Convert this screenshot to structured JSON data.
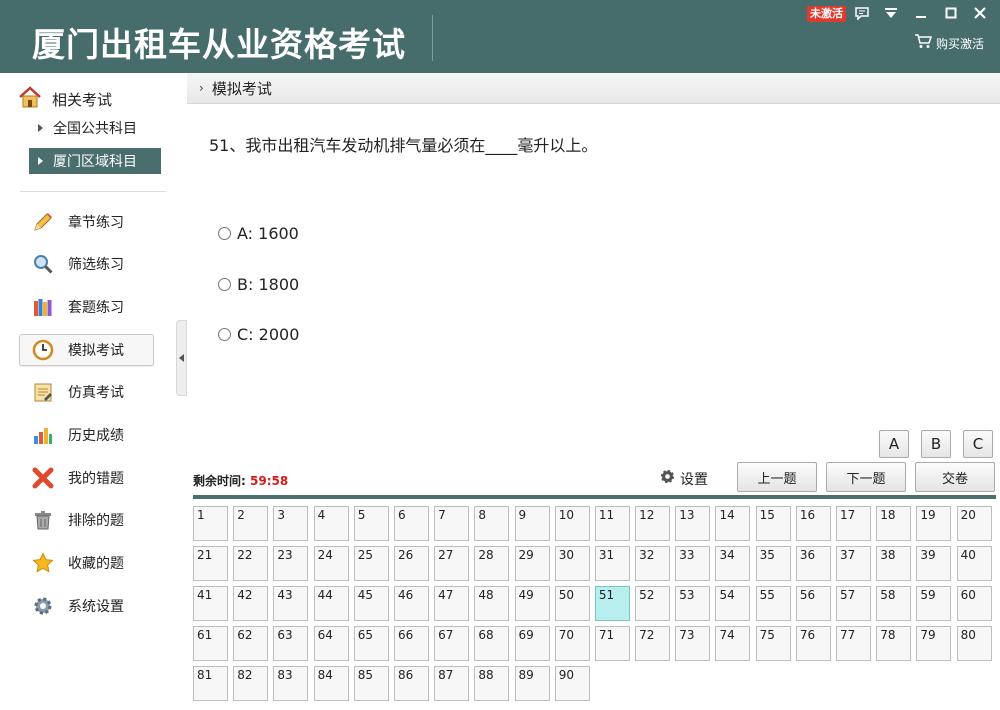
{
  "window": {
    "title": "厦门出租车从业资格考试",
    "badge": "未激活",
    "buy_label": "购买激活"
  },
  "sidebar": {
    "header": "相关考试",
    "subitems": [
      {
        "label": "全国公共科目",
        "active": false
      },
      {
        "label": "厦门区域科目",
        "active": true
      }
    ],
    "items": [
      {
        "label": "章节练习",
        "icon": "pencil-icon"
      },
      {
        "label": "筛选练习",
        "icon": "magnifier-icon"
      },
      {
        "label": "套题练习",
        "icon": "books-icon"
      },
      {
        "label": "模拟考试",
        "icon": "clock-icon",
        "active": true
      },
      {
        "label": "仿真考试",
        "icon": "notepad-icon"
      },
      {
        "label": "历史成绩",
        "icon": "bar-chart-icon"
      },
      {
        "label": "我的错题",
        "icon": "red-x-icon"
      },
      {
        "label": "排除的题",
        "icon": "trash-icon"
      },
      {
        "label": "收藏的题",
        "icon": "star-icon"
      },
      {
        "label": "系统设置",
        "icon": "gear-icon"
      }
    ]
  },
  "breadcrumb": "模拟考试",
  "question": {
    "text": "51、我市出租汽车发动机排气量必须在____毫升以上。",
    "options": [
      "A: 1600",
      "B: 1800",
      "C: 2000"
    ]
  },
  "answer_buttons": [
    "A",
    "B",
    "C"
  ],
  "timer": {
    "label": "剩余时间:",
    "value": "59:58"
  },
  "controls": {
    "settings": "设置",
    "prev": "上一题",
    "next": "下一题",
    "submit": "交卷"
  },
  "grid": {
    "total": 90,
    "current": 51
  }
}
